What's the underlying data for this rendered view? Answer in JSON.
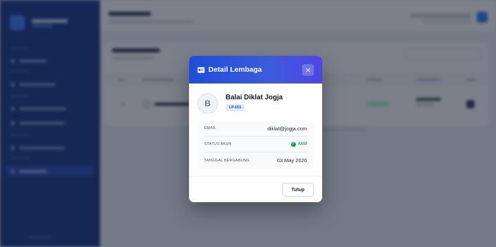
{
  "modal": {
    "title": "Detail Lembaga",
    "close_glyph": "×",
    "avatar_letter": "B",
    "name": "Balai Diklat Jogja",
    "code": "LP-001",
    "fields": [
      {
        "label": "EMAIL",
        "value": "diklat@jogja.com"
      },
      {
        "label": "STATUS AKUN",
        "value": "Aktif"
      },
      {
        "label": "TANGGAL BERGABUNG",
        "value": "03 May 2026"
      }
    ],
    "status_check_glyph": "✓",
    "close_button_label": "Tutup"
  },
  "colors": {
    "header_gradient_start": "#1d4ed8",
    "header_gradient_end": "#4f46e5",
    "status_active": "#16a34a",
    "code_badge_bg": "#dbeafe",
    "sidebar_bg": "#1e3a8a"
  },
  "icons": {
    "header": "id-card-icon",
    "close": "close-icon",
    "status": "check-circle-icon"
  }
}
